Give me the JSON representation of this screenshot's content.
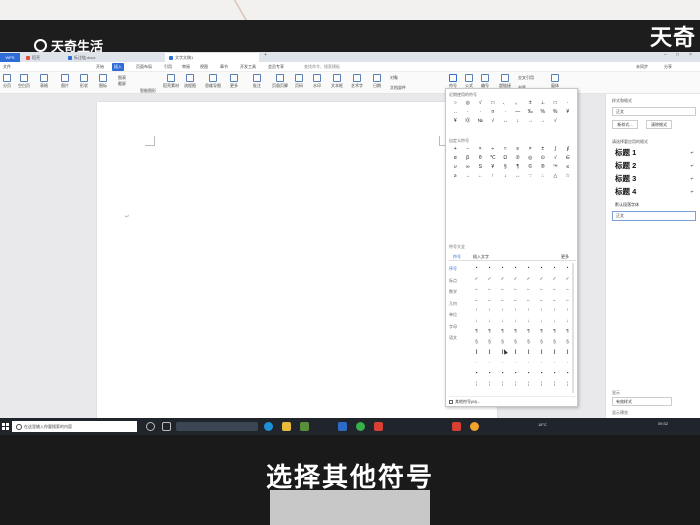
{
  "brand": {
    "logo_text": "天奇生活",
    "corner_text": "天奇"
  },
  "caption": "选择其他符号",
  "tabs": [
    {
      "label": "稻壳"
    },
    {
      "label": "标注链.docx"
    },
    {
      "label": "文字文稿1"
    }
  ],
  "menu": [
    "文件",
    "开始",
    "插入",
    "页面布局",
    "引用",
    "审阅",
    "视图",
    "章节",
    "开发工具",
    "会员专享"
  ],
  "menu_search": "查找命令、搜索模板",
  "menu_right": {
    "collab": "未同步",
    "share": "分享"
  },
  "ribbon": {
    "items": [
      "分页",
      "空白页",
      "表格",
      "图片",
      "形状",
      "图标",
      "稻壳素材",
      "流程图",
      "思维导图",
      "更多",
      "批注",
      "页眉页脚",
      "页码",
      "水印",
      "文本框",
      "艺术字",
      "日期",
      "对象",
      "文档部件",
      "符号",
      "公式",
      "编号",
      "超链接",
      "交叉引用",
      "书签",
      "窗体"
    ],
    "small": {
      "chart": "图表",
      "screenshot": "截屏",
      "smart": "智能图形"
    }
  },
  "symbol_panel": {
    "recent_title": "近期使用的符号",
    "recent": [
      "○",
      "◎",
      "√",
      "□",
      "、",
      "。",
      "±",
      "⊥",
      "□",
      "·",
      "‥",
      "·",
      "·",
      "¤",
      "·",
      "—",
      "‰",
      "%",
      "%",
      "¥",
      "¥",
      "Ⓞ",
      "№",
      "√",
      "↔",
      "↓",
      "→",
      "→",
      "√"
    ],
    "custom_title": "自定义符号",
    "custom": [
      "+",
      "−",
      "×",
      "÷",
      "≈",
      "≡",
      "≠",
      "±",
      "∫",
      "∮",
      "α",
      "β",
      "θ",
      "℃",
      "Ω",
      "②",
      "◎",
      "⊙",
      "√",
      "∈",
      "∪",
      "∞",
      "S",
      "¥",
      "§",
      "¶",
      "©",
      "®",
      "™",
      "≤",
      "≥",
      "→",
      "←",
      "↑",
      "↓",
      "↔",
      "∵",
      "∴",
      "△",
      "☆"
    ],
    "library_title": "符号大全",
    "library_tabs": {
      "symbol": "符号",
      "insert": "插入文字",
      "more": "更多"
    },
    "categories": [
      "序号",
      "标点",
      "数学",
      "几何",
      "单位",
      "字母",
      "语文"
    ],
    "library_rows": [
      [
        "•",
        "•",
        "•",
        "•",
        "•",
        "•",
        "•",
        "•"
      ],
      [
        "✓",
        "✓",
        "✓",
        "✓",
        "✓",
        "✓",
        "✓",
        "✓"
      ],
      [
        "←",
        "←",
        "←",
        "←",
        "←",
        "←",
        "←",
        "←"
      ],
      [
        "←",
        "←",
        "←",
        "←",
        "←",
        "←",
        "←",
        "←"
      ],
      [
        "↑",
        "↑",
        "↑",
        "↑",
        "↑",
        "↑",
        "↑",
        "↑"
      ],
      [
        "↓",
        "↓",
        "↓",
        "↓",
        "↓",
        "↓",
        "↓",
        "↓"
      ],
      [
        "¶",
        "¶",
        "¶",
        "¶",
        "¶",
        "¶",
        "¶",
        "¶"
      ],
      [
        "§",
        "§",
        "§",
        "§",
        "§",
        "§",
        "§",
        "§"
      ],
      [
        "∥",
        "∥",
        "∥",
        "∥",
        "∥",
        "∥",
        "∥",
        "∥"
      ],
      [
        "·",
        "·",
        "·",
        "·",
        "·",
        "·",
        "·",
        "·"
      ],
      [
        "▪",
        "▪",
        "▪",
        "▪",
        "▪",
        "▪",
        "▪",
        "▪"
      ],
      [
        "¦",
        "¦",
        "¦",
        "¦",
        "¦",
        "¦",
        "¦",
        "¦"
      ]
    ],
    "more_symbols": "其他符号(M)..."
  },
  "right_pane": {
    "title": "样式和格式",
    "current_style": "正文",
    "new_style": "新样式...",
    "clear_format": "清除格式",
    "apply_title": "请选择要应用的格式",
    "headings": [
      "标题 1",
      "标题 2",
      "标题 3",
      "标题 4"
    ],
    "default_para": "默认段落字体",
    "normal": "正文",
    "show_label": "显示",
    "show_value": "有效样式",
    "preview": "显示预览"
  },
  "statusbar": {
    "page": "页码: 1/1",
    "words": "字数: 0",
    "spell": "拼写检查",
    "doc_check": "文档校对",
    "zoom": "100%"
  },
  "taskbar": {
    "search": "在这里输入你要搜索的内容",
    "weather": "18°C",
    "time": "09:32"
  }
}
